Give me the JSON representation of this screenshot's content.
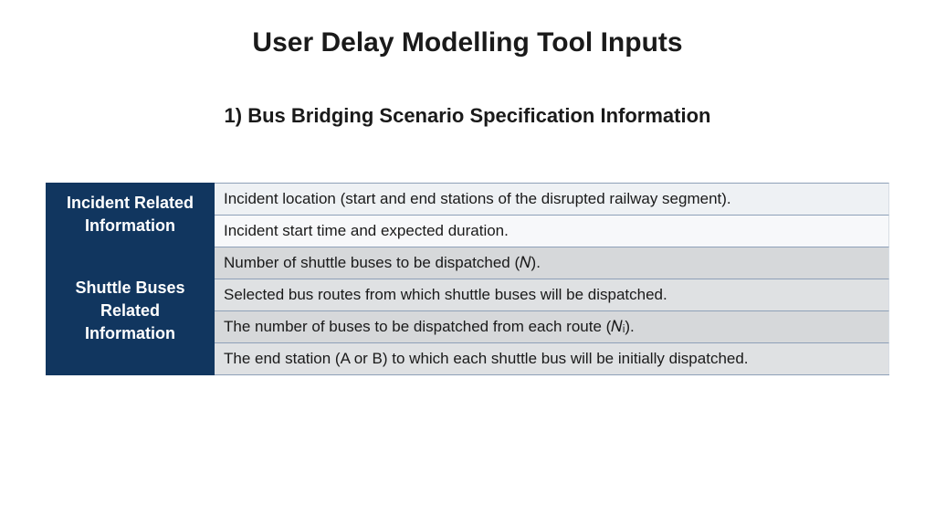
{
  "title": "User Delay Modelling Tool Inputs",
  "subtitle": "1) Bus Bridging Scenario Specification Information",
  "groups": [
    {
      "header": "Incident Related Information",
      "rows": [
        "Incident location (start and end stations of the disrupted railway segment).",
        "Incident start time and expected duration."
      ]
    },
    {
      "header": "Shuttle Buses Related Information",
      "rows": [
        "Number of shuttle buses to be dispatched (𝑁).",
        "Selected bus routes from which shuttle buses will be dispatched.",
        "The number of buses to be dispatched from each route (𝑁ᵢ).",
        "The end station (A or B) to which each shuttle bus will be initially dispatched."
      ]
    }
  ]
}
